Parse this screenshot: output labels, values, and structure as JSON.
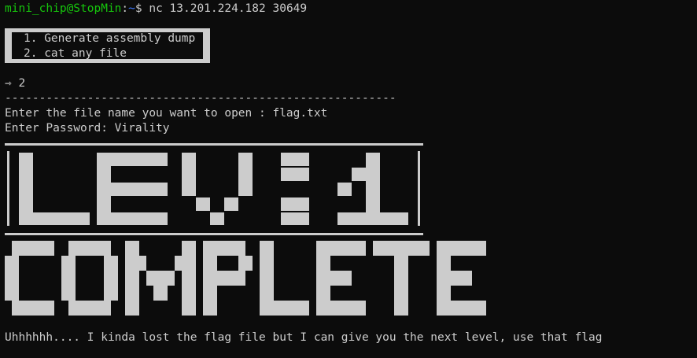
{
  "terminal": {
    "prompt_user": "mini_chip@StopMin",
    "prompt_sep": ":",
    "prompt_path": "~",
    "prompt_symbol": "$ ",
    "command": "nc 13.201.224.182 30649"
  },
  "menu": {
    "items": [
      "1. Generate assembly dump",
      "2. cat any file"
    ]
  },
  "session": {
    "selection": "⇾ 2",
    "separator": "---------------------------------------------------------",
    "file_prompt": "Enter the file name you want to open : flag.txt",
    "password_prompt": "Enter Password: Virality"
  },
  "banner": {
    "line1": "LEVEL 1",
    "line2": "COMPLETE"
  },
  "footer": {
    "message": "Uhhhhhh.... I kinda lost the flag file but I can give you the next level, use that flag"
  },
  "colors": {
    "background": "#0c0c0c",
    "foreground": "#cccccc",
    "user": "#16c60c",
    "path": "#3b78ff"
  }
}
